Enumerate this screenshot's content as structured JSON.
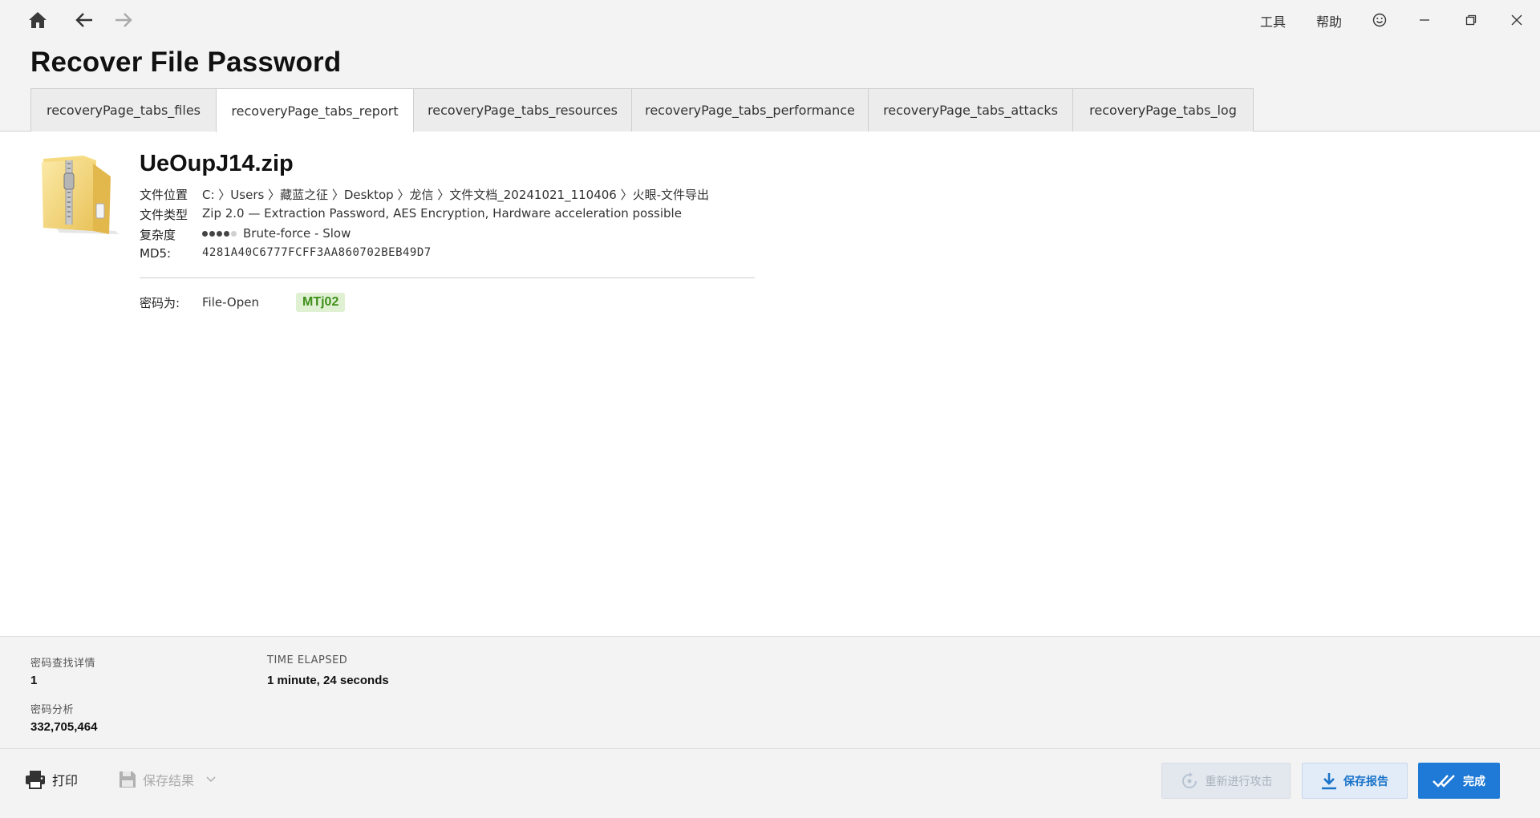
{
  "topbar": {
    "menu": [
      {
        "label": "工具"
      },
      {
        "label": "帮助"
      }
    ]
  },
  "page_title": "Recover File Password",
  "tabs": [
    {
      "label": "recoveryPage_tabs_files",
      "active": false
    },
    {
      "label": "recoveryPage_tabs_report",
      "active": true
    },
    {
      "label": "recoveryPage_tabs_resources",
      "active": false
    },
    {
      "label": "recoveryPage_tabs_performance",
      "active": false
    },
    {
      "label": "recoveryPage_tabs_attacks",
      "active": false
    },
    {
      "label": "recoveryPage_tabs_log",
      "active": false
    }
  ],
  "file": {
    "name": "UeOupJ14.zip",
    "location_label": "文件位置",
    "location_value": "C: 〉Users 〉藏蓝之征 〉Desktop 〉龙信 〉文件文档_20241021_110406 〉火眼-文件导出",
    "type_label": "文件类型",
    "type_value": "Zip 2.0 — Extraction Password, AES Encryption, Hardware acceleration possible",
    "complexity_label": "复杂度",
    "complexity_level": 4,
    "complexity_max": 5,
    "complexity_value": "Brute-force - Slow",
    "md5_label": "MD5:",
    "md5_value": "4281A40C6777FCFF3AA860702BEB49D7"
  },
  "password": {
    "label": "密码为:",
    "source": "File-Open",
    "value": "MTj02"
  },
  "stats": {
    "found_label": "密码查找详情",
    "found_value": "1",
    "elapsed_label": "TIME ELAPSED",
    "elapsed_value": "1 minute, 24 seconds",
    "analyzed_label": "密码分析",
    "analyzed_value": "332,705,464"
  },
  "footer": {
    "print_label": "打印",
    "save_result_label": "保存结果",
    "retry_label": "重新进行攻击",
    "save_report_label": "保存报告",
    "done_label": "完成"
  },
  "colors": {
    "accent": "#1e7ad6",
    "password_badge_bg": "#dff1d2",
    "password_badge_text": "#3f8f1a"
  }
}
